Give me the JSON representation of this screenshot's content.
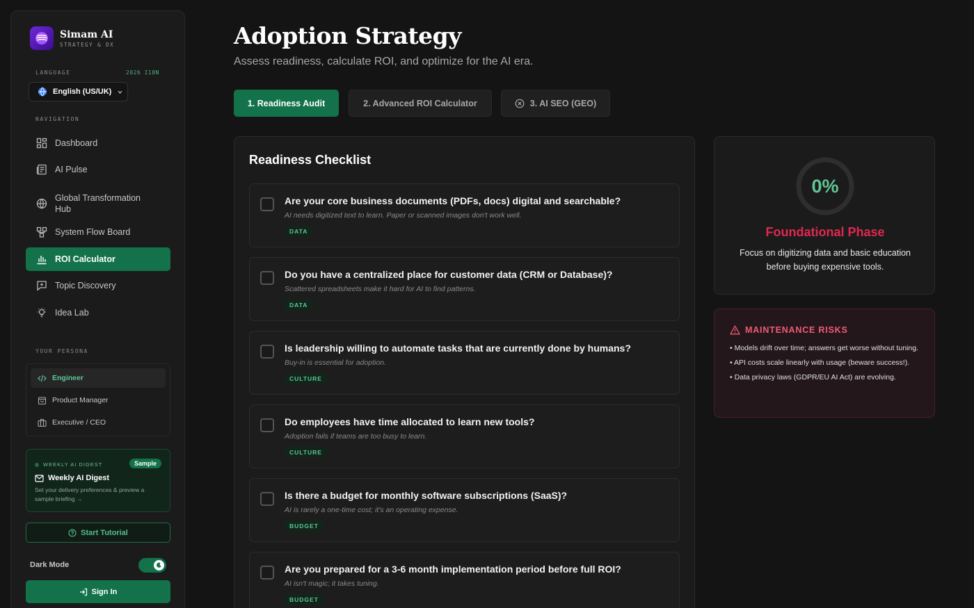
{
  "brand": {
    "name": "Simam AI",
    "subtitle": "STRATEGY & DX"
  },
  "language": {
    "section_label": "LANGUAGE",
    "tag": "2026 I18N",
    "selected": "English (US/UK)"
  },
  "navigation": {
    "section_label": "NAVIGATION",
    "items": [
      {
        "label": "Dashboard",
        "icon": "grid-icon"
      },
      {
        "label": "AI Pulse",
        "icon": "newspaper-icon"
      },
      {
        "label": "Global Transformation Hub",
        "icon": "globe-icon"
      },
      {
        "label": "System Flow Board",
        "icon": "flow-icon"
      },
      {
        "label": "ROI Calculator",
        "icon": "bar-chart-icon",
        "active": true
      },
      {
        "label": "Topic Discovery",
        "icon": "message-plus-icon"
      },
      {
        "label": "Idea Lab",
        "icon": "lightbulb-icon"
      }
    ]
  },
  "persona": {
    "section_label": "YOUR PERSONA",
    "items": [
      {
        "label": "Engineer",
        "icon": "code-icon",
        "active": true
      },
      {
        "label": "Product Manager",
        "icon": "shopping-bag-icon"
      },
      {
        "label": "Executive / CEO",
        "icon": "briefcase-icon"
      }
    ]
  },
  "digest": {
    "label": "WEEKLY AI DIGEST",
    "badge": "Sample",
    "title": "Weekly AI Digest",
    "description": "Set your delivery preferences & preview a sample briefing →"
  },
  "tutorial_label": "Start Tutorial",
  "dark_mode": {
    "label": "Dark Mode",
    "on": true
  },
  "sign_in_label": "Sign In",
  "page": {
    "title": "Adoption Strategy",
    "subtitle": "Assess readiness, calculate ROI, and optimize for the AI era."
  },
  "tabs": [
    {
      "label": "1. Readiness Audit",
      "active": true
    },
    {
      "label": "2. Advanced ROI Calculator"
    },
    {
      "label": "3. AI SEO (GEO)",
      "icon": "x-circle-icon"
    }
  ],
  "checklist": {
    "title": "Readiness Checklist",
    "items": [
      {
        "question": "Are your core business documents (PDFs, docs) digital and searchable?",
        "hint": "AI needs digitized text to learn. Paper or scanned images don't work well.",
        "tag": "DATA"
      },
      {
        "question": "Do you have a centralized place for customer data (CRM or Database)?",
        "hint": "Scattered spreadsheets make it hard for AI to find patterns.",
        "tag": "DATA"
      },
      {
        "question": "Is leadership willing to automate tasks that are currently done by humans?",
        "hint": "Buy-in is essential for adoption.",
        "tag": "CULTURE"
      },
      {
        "question": "Do employees have time allocated to learn new tools?",
        "hint": "Adoption fails if teams are too busy to learn.",
        "tag": "CULTURE"
      },
      {
        "question": "Is there a budget for monthly software subscriptions (SaaS)?",
        "hint": "AI is rarely a one-time cost; it's an operating expense.",
        "tag": "BUDGET"
      },
      {
        "question": "Are you prepared for a 3-6 month implementation period before full ROI?",
        "hint": "AI isn't magic; it takes tuning.",
        "tag": "BUDGET"
      }
    ]
  },
  "score": {
    "value": "0%",
    "progress": 0,
    "phase": "Foundational Phase",
    "description": "Focus on digitizing data and basic education before buying expensive tools."
  },
  "risks": {
    "title": "MAINTENANCE RISKS",
    "items": [
      "• Models drift over time; answers get worse without tuning.",
      "• API costs scale linearly with usage (beware success!).",
      "• Data privacy laws (GDPR/EU AI Act) are evolving."
    ]
  },
  "colors": {
    "accent": "#13724a",
    "accent_text": "#5fc795",
    "danger": "#e0294f",
    "risk_title": "#f05a75",
    "background": "#141414"
  }
}
